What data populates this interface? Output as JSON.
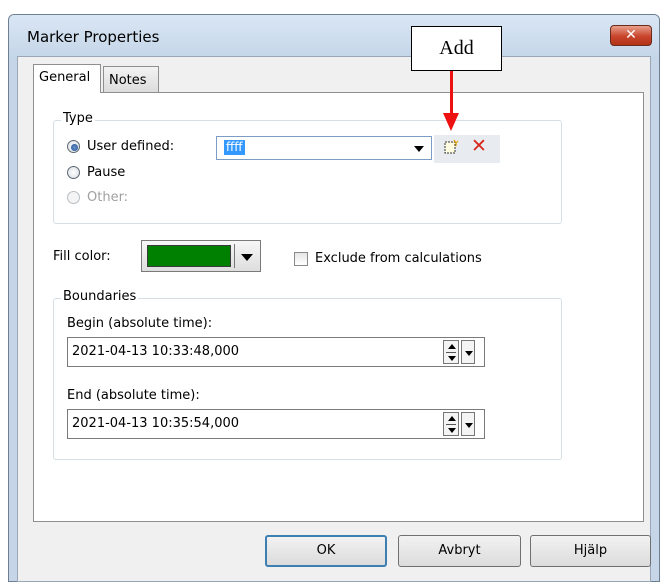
{
  "window": {
    "title": "Marker Properties",
    "close_glyph": "✕"
  },
  "tabs": [
    {
      "label": "General",
      "selected": true
    },
    {
      "label": "Notes",
      "selected": false
    }
  ],
  "type_group": {
    "label": "Type",
    "options": [
      {
        "label": "User defined:",
        "checked": true,
        "enabled": true
      },
      {
        "label": "Pause",
        "checked": false,
        "enabled": true
      },
      {
        "label": "Other:",
        "checked": false,
        "enabled": false
      }
    ],
    "user_defined_value": "ffff",
    "add_icon": "new-item-icon",
    "delete_icon": "delete-x-icon",
    "delete_glyph": "✕",
    "delete_color": "#d62a1e"
  },
  "fill": {
    "label": "Fill color:",
    "color": "#008000"
  },
  "exclude": {
    "label": "Exclude from calculations",
    "checked": false
  },
  "boundaries": {
    "label": "Boundaries",
    "begin_label": "Begin (absolute time):",
    "begin_value": "2021-04-13 10:33:48,000",
    "end_label": "End (absolute time):",
    "end_value": "2021-04-13 10:35:54,000"
  },
  "buttons": {
    "ok": "OK",
    "cancel": "Avbryt",
    "help": "Hjälp"
  },
  "annotation": {
    "label": "Add",
    "arrow_color": "#ee1111"
  }
}
